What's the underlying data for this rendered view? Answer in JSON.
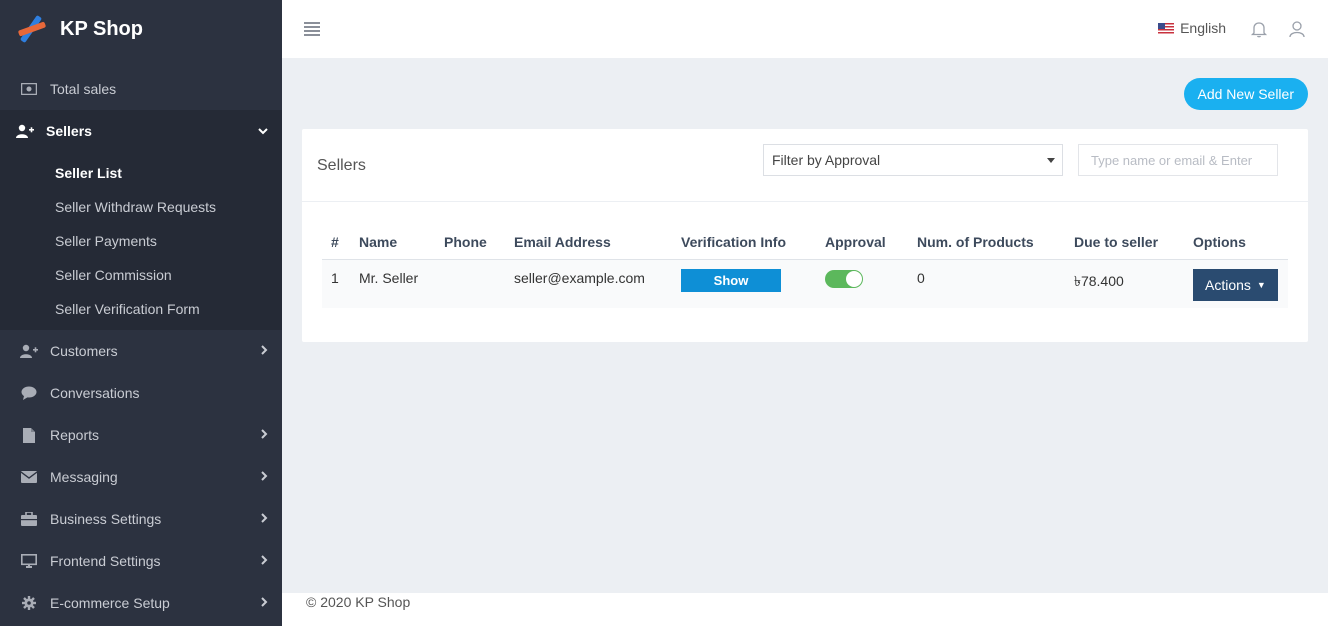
{
  "brand": {
    "name": "KP Shop"
  },
  "sidebar": {
    "items": [
      {
        "label": "Total sales",
        "icon": "money-icon"
      },
      {
        "label": "Sellers",
        "icon": "user-plus-icon",
        "chevron": "chevron-down"
      },
      {
        "label": "Customers",
        "icon": "user-plus-icon",
        "chevron": "chevron-right"
      },
      {
        "label": "Conversations",
        "icon": "chat-icon"
      },
      {
        "label": "Reports",
        "icon": "file-icon",
        "chevron": "chevron-right"
      },
      {
        "label": "Messaging",
        "icon": "envelope-icon",
        "chevron": "chevron-right"
      },
      {
        "label": "Business Settings",
        "icon": "briefcase-icon",
        "chevron": "chevron-right"
      },
      {
        "label": "Frontend Settings",
        "icon": "desktop-icon",
        "chevron": "chevron-right"
      },
      {
        "label": "E-commerce Setup",
        "icon": "gear-icon",
        "chevron": "chevron-right"
      }
    ],
    "sellers_sub": [
      {
        "label": "Seller List"
      },
      {
        "label": "Seller Withdraw Requests"
      },
      {
        "label": "Seller Payments"
      },
      {
        "label": "Seller Commission"
      },
      {
        "label": "Seller Verification Form"
      }
    ]
  },
  "topbar": {
    "language": "English"
  },
  "main": {
    "add_button": "Add New Seller",
    "card_title": "Sellers",
    "filter": {
      "selected": "Filter by Approval"
    },
    "search": {
      "placeholder": "Type name or email & Enter",
      "value": ""
    },
    "table": {
      "headers": [
        "#",
        "Name",
        "Phone",
        "Email Address",
        "Verification Info",
        "Approval",
        "Num. of Products",
        "Due to seller",
        "Options"
      ],
      "rows": [
        {
          "index": "1",
          "name": "Mr. Seller",
          "phone": "",
          "email": "seller@example.com",
          "verification_button": "Show",
          "approval_on": true,
          "num_products": "0",
          "due": "৳78.400",
          "options_button": "Actions"
        }
      ]
    }
  },
  "footer": {
    "text": "© 2020 KP Shop"
  },
  "colors": {
    "sidebar_bg": "#2c3240",
    "accent_blue": "#1ab0f0",
    "show_button": "#0e8fd6",
    "actions_button": "#2a4b70",
    "toggle_on": "#5cb85c"
  }
}
